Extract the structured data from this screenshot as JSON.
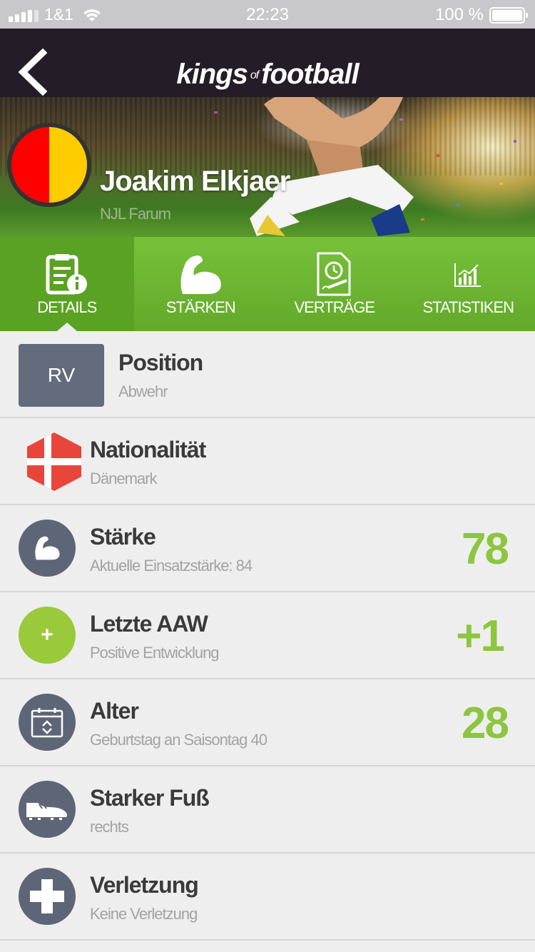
{
  "status_bar": {
    "carrier": "1&1",
    "time": "22:23",
    "battery": "100 %"
  },
  "header": {
    "logo_kings": "kings",
    "logo_of": "of",
    "logo_football": "football"
  },
  "player": {
    "name": "Joakim Elkjaer",
    "club": "NJL Farum",
    "club_colors": [
      "#ff0000",
      "#ffcc00"
    ]
  },
  "tabs": [
    {
      "label": "DETAILS",
      "icon": "document-info-icon",
      "active": true
    },
    {
      "label": "STÄRKEN",
      "icon": "muscle-arm-icon",
      "active": false
    },
    {
      "label": "VERTRÄGE",
      "icon": "contract-icon",
      "active": false
    },
    {
      "label": "STATISTIKEN",
      "icon": "bar-chart-icon",
      "active": false
    }
  ],
  "details": {
    "position": {
      "badge": "RV",
      "title": "Position",
      "subtitle": "Abwehr"
    },
    "nationality": {
      "title": "Nationalität",
      "subtitle": "Dänemark",
      "icon": "denmark-flag-icon"
    },
    "strength": {
      "title": "Stärke",
      "subtitle": "Aktuelle Einsatzstärke: 84",
      "value": "78",
      "icon": "muscle-arm-icon"
    },
    "last_aaw": {
      "title": "Letzte AAW",
      "subtitle": "Positive Entwicklung",
      "value": "+1",
      "icon_symbol": "+"
    },
    "age": {
      "title": "Alter",
      "subtitle": "Geburtstag an Saisontag 40",
      "value": "28",
      "icon": "calendar-icon"
    },
    "foot": {
      "title": "Starker Fuß",
      "subtitle": "rechts",
      "icon": "football-boot-icon"
    },
    "injury": {
      "title": "Verletzung",
      "subtitle": "Keine Verletzung",
      "icon": "medical-cross-icon"
    }
  },
  "colors": {
    "accent_green": "#8cc63f",
    "tab_green": "#6db433",
    "nav_dark": "#241c27",
    "icon_gray": "#5e6577",
    "position_badge": "#636b7d"
  }
}
